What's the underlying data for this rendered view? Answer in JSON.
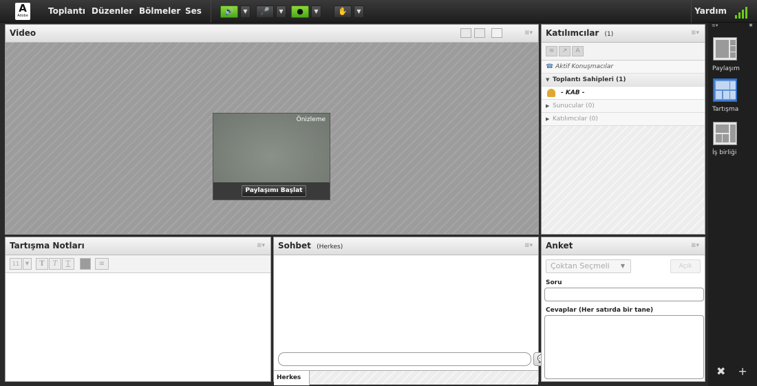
{
  "topbar": {
    "logo_letter": "A",
    "logo_word": "Adobe",
    "menu": [
      "Toplantı",
      "Düzenler",
      "Bölmeler",
      "Ses"
    ],
    "help": "Yardım",
    "icons": [
      "speaker-icon",
      "microphone-icon",
      "webcam-icon",
      "raise-hand-icon"
    ]
  },
  "video": {
    "title": "Video",
    "preview_label": "Önizleme",
    "start_button": "Paylaşımı Başlat"
  },
  "participants": {
    "title": "Katılımcılar",
    "count": "(1)",
    "active_speakers": "Aktif Konuşmacılar",
    "hosts": "Toplantı Sahipleri (1)",
    "host_user": "- KAB -",
    "presenters": "Sunucular (0)",
    "attendees": "Katılımcılar (0)"
  },
  "notes": {
    "title": "Tartışma Notları",
    "font_size": "11"
  },
  "chat": {
    "title": "Sohbet",
    "scope": "(Herkes)",
    "tab": "Herkes"
  },
  "poll": {
    "title": "Anket",
    "type": "Çoktan Seçmeli",
    "open_button": "Açık",
    "question_label": "Soru",
    "answers_label": "Cevaplar (Her satırda bir tane)"
  },
  "layouts": {
    "items": [
      {
        "label": "Paylaşım",
        "selected": false
      },
      {
        "label": "Tartışma",
        "selected": true
      },
      {
        "label": "İş birliği",
        "selected": false
      }
    ]
  },
  "colors": {
    "accent_green": "#6ecb1a",
    "layout_selected": "#5b8fd6"
  }
}
